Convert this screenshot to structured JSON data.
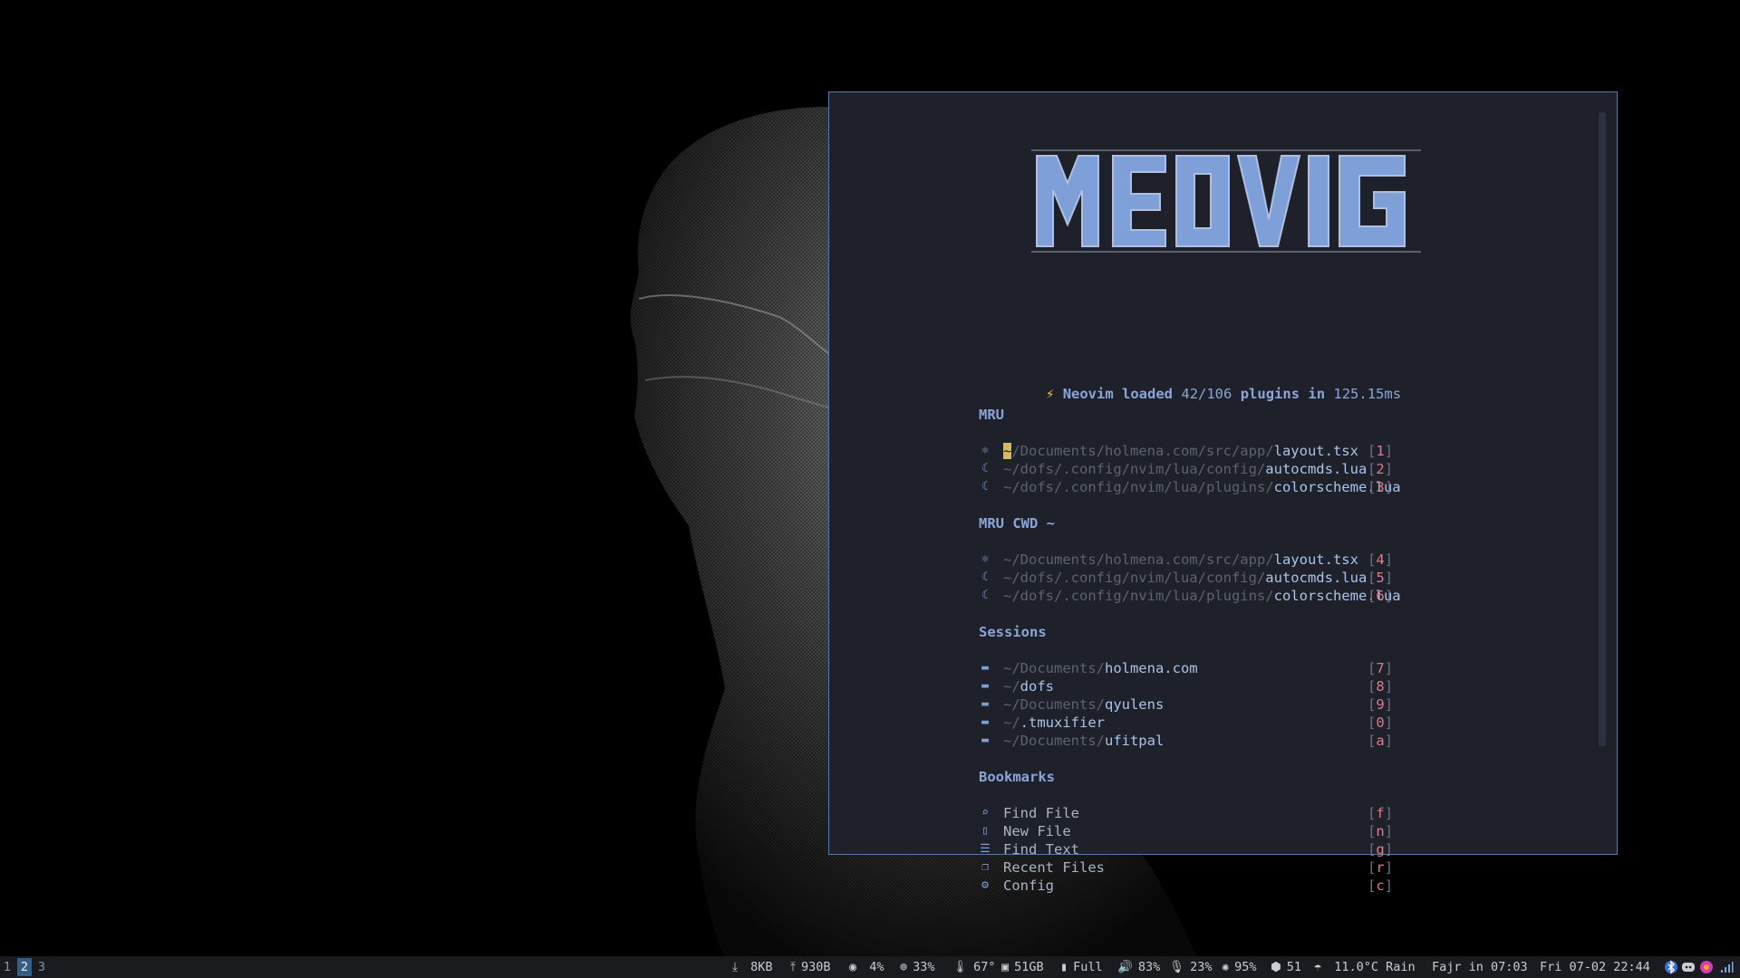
{
  "dashboard": {
    "logo_text": "MEOVIG",
    "startup": {
      "prefix": "Neovim loaded",
      "loaded": "42/106",
      "mid": "plugins",
      "in": "in",
      "time": "125.15ms"
    },
    "sections": {
      "mru": {
        "title": "MRU",
        "items": [
          {
            "icon": "react-icon",
            "dir": "~/Documents/holmena.com/src/app/",
            "file": "layout.tsx",
            "key": "1"
          },
          {
            "icon": "lua-icon",
            "dir": "~/dofs/.config/nvim/lua/config/",
            "file": "autocmds.lua",
            "key": "2"
          },
          {
            "icon": "lua-icon",
            "dir": "~/dofs/.config/nvim/lua/plugins/",
            "file": "colorscheme.lua",
            "key": "3"
          }
        ]
      },
      "mru_cwd": {
        "title": "MRU CWD ~",
        "items": [
          {
            "icon": "react-icon",
            "dir": "~/Documents/holmena.com/src/app/",
            "file": "layout.tsx",
            "key": "4"
          },
          {
            "icon": "lua-icon",
            "dir": "~/dofs/.config/nvim/lua/config/",
            "file": "autocmds.lua",
            "key": "5"
          },
          {
            "icon": "lua-icon",
            "dir": "~/dofs/.config/nvim/lua/plugins/",
            "file": "colorscheme.lua",
            "key": "6"
          }
        ]
      },
      "sessions": {
        "title": "Sessions",
        "items": [
          {
            "icon": "folder-icon",
            "dir": "~/Documents/",
            "file": "holmena.com",
            "key": "7"
          },
          {
            "icon": "folder-icon",
            "dir": "~/",
            "file": "dofs",
            "key": "8"
          },
          {
            "icon": "folder-icon",
            "dir": "~/Documents/",
            "file": "qyulens",
            "key": "9"
          },
          {
            "icon": "folder-icon",
            "dir": "~/",
            "file": ".tmuxifier",
            "key": "0"
          },
          {
            "icon": "folder-icon",
            "dir": "~/Documents/",
            "file": "ufitpal",
            "key": "a"
          }
        ]
      },
      "bookmarks": {
        "title": "Bookmarks",
        "items": [
          {
            "icon": "search-icon",
            "label": "Find File",
            "key": "f"
          },
          {
            "icon": "file-icon",
            "label": "New File",
            "key": "n"
          },
          {
            "icon": "text-lines-icon",
            "label": "Find Text",
            "key": "g"
          },
          {
            "icon": "copy-icon",
            "label": "Recent Files",
            "key": "r"
          },
          {
            "icon": "gear-icon",
            "label": "Config",
            "key": "c"
          }
        ]
      }
    }
  },
  "statusbar": {
    "workspaces": [
      "1",
      "2",
      "3"
    ],
    "active_workspace": "2",
    "download": "8KB",
    "upload": "930B",
    "cpu": "4%",
    "memory": "33%",
    "temperature": "67°",
    "disk": "51GB",
    "battery": "Full",
    "volume": "83%",
    "mic": "23%",
    "brightness": "95%",
    "updates": "51",
    "weather": "11.0°C Rain",
    "prayer": "Fajr in 07:03",
    "datetime": "Fri 07-02 22:44"
  },
  "colors": {
    "accent": "#8aa6d8",
    "key": "#e27a8a",
    "background": "#1e2129",
    "active_workspace": "#355f86"
  }
}
